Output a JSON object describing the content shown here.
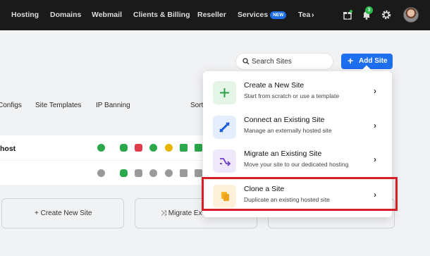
{
  "nav": {
    "items": [
      {
        "label": "Hosting"
      },
      {
        "label": "Domains"
      },
      {
        "label": "Webmail"
      },
      {
        "label": "Clients & Billing"
      },
      {
        "label": "Reseller"
      },
      {
        "label": "Services"
      },
      {
        "label": "Tea"
      }
    ],
    "services_badge": "NEW",
    "notification_count": "3",
    "icons": [
      "gift-icon",
      "bell-icon",
      "gear-icon",
      "avatar"
    ]
  },
  "search": {
    "placeholder": "Search Sites"
  },
  "add_site": {
    "label": "Add Site"
  },
  "tabs": [
    {
      "label": "Configs"
    },
    {
      "label": "Site Templates"
    },
    {
      "label": "IP Banning"
    },
    {
      "label": "Sort"
    }
  ],
  "rows": {
    "first_label": "host"
  },
  "bottom_buttons": [
    {
      "label": "+ Create New Site"
    },
    {
      "label": "Migrate Ex"
    }
  ],
  "dropdown": {
    "items": [
      {
        "title": "Create a New Site",
        "desc": "Start from scratch or use a template",
        "icon": "plus-icon"
      },
      {
        "title": "Connect an Existing Site",
        "desc": "Manage an externally hosted site",
        "icon": "plug-icon"
      },
      {
        "title": "Migrate an Existing Site",
        "desc": "Move your site to our dedicated hosting",
        "icon": "migrate-icon"
      },
      {
        "title": "Clone a Site",
        "desc": "Duplicate an existing hosted site",
        "icon": "copy-icon"
      }
    ]
  },
  "colors": {
    "accent": "#1e6ef0",
    "highlight": "#d61f26",
    "success": "#29b84a"
  }
}
